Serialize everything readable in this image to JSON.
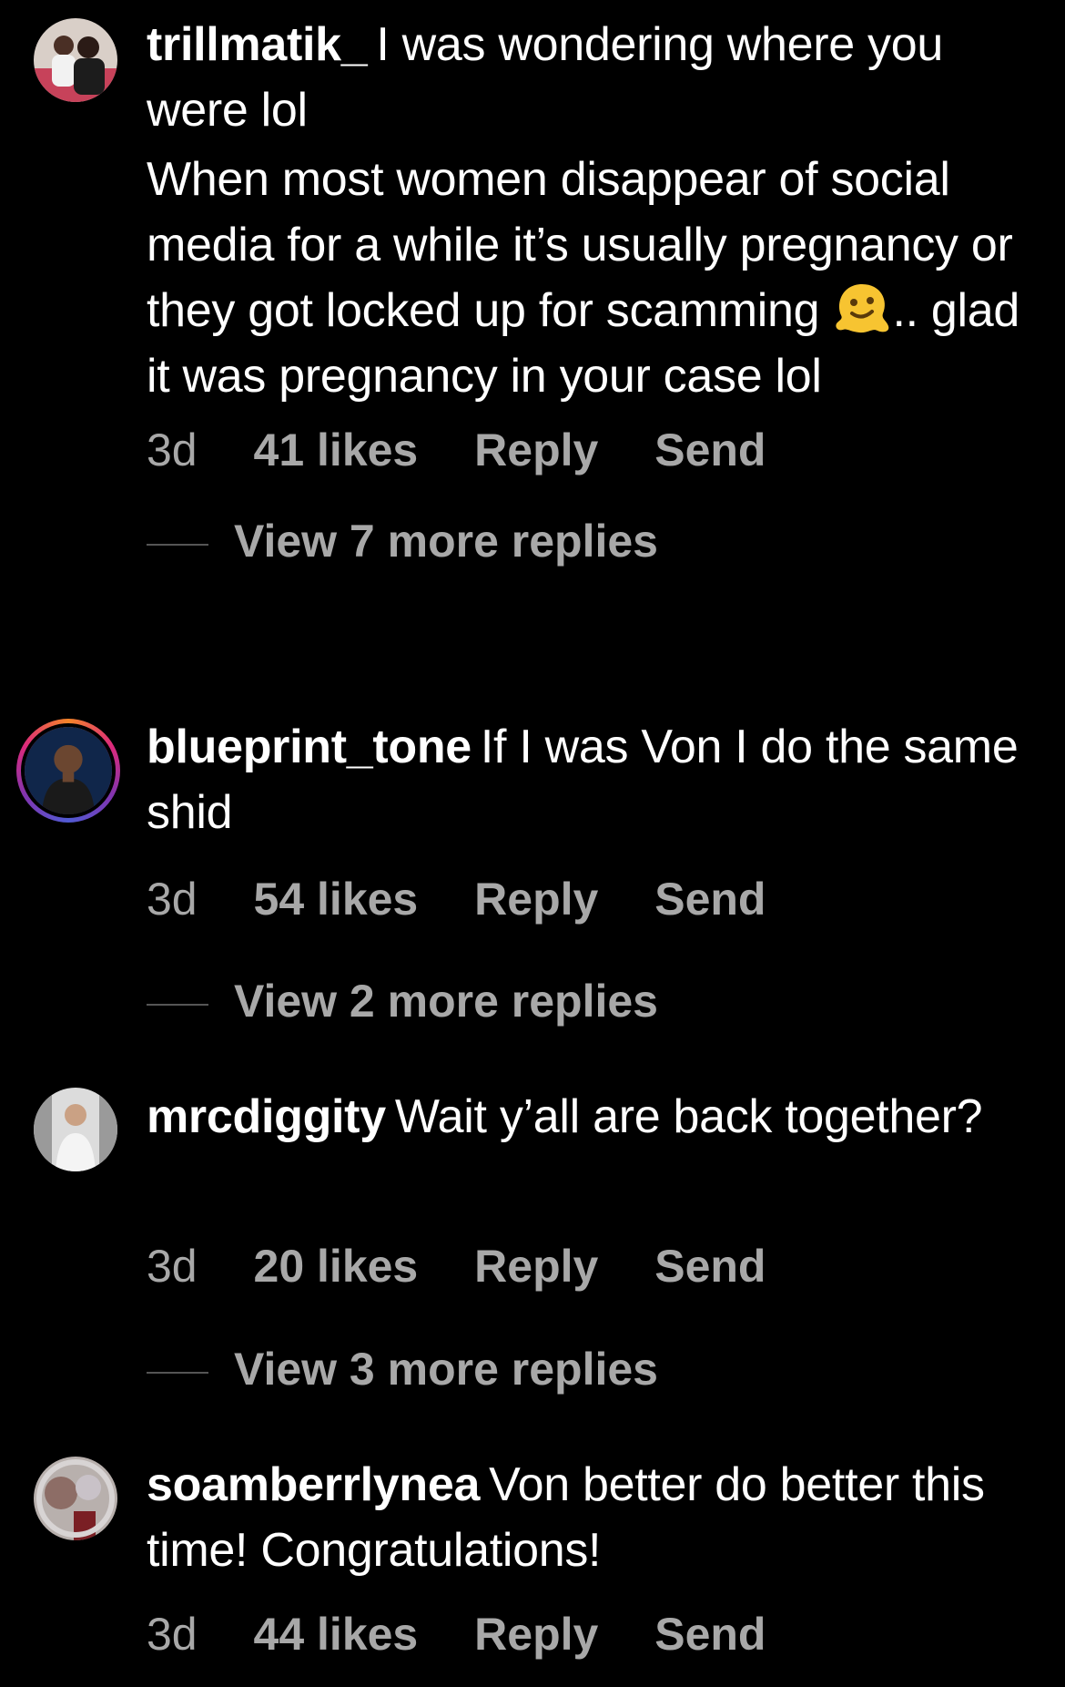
{
  "comments": [
    {
      "username": "trillmatik_",
      "paragraphs": [
        "I was wondering where you were lol",
        "When most women disappear of social media for a while it’s usually pregnancy or they got locked up for scamming"
      ],
      "after_emoji": ".. glad it was pregnancy in your case lol",
      "emoji": "melting-face",
      "time": "3d",
      "likes": "41 likes",
      "reply": "Reply",
      "send": "Send",
      "view_replies": "View 7 more replies"
    },
    {
      "username": "blueprint_tone",
      "text": "If I was Von I do the same shid",
      "time": "3d",
      "likes": "54 likes",
      "reply": "Reply",
      "send": "Send",
      "view_replies": "View 2 more replies"
    },
    {
      "username": "mrcdiggity",
      "text": "Wait y’all are back together?",
      "time": "3d",
      "likes": "20 likes",
      "reply": "Reply",
      "send": "Send",
      "view_replies": "View 3 more replies"
    },
    {
      "username": "soamberrlynea",
      "text": "Von better do better this time! Congratulations!",
      "time": "3d",
      "likes": "44 likes",
      "reply": "Reply",
      "send": "Send"
    }
  ],
  "colors": {
    "background": "#000000",
    "text": "#ffffff",
    "muted": "#a8a8a8"
  }
}
